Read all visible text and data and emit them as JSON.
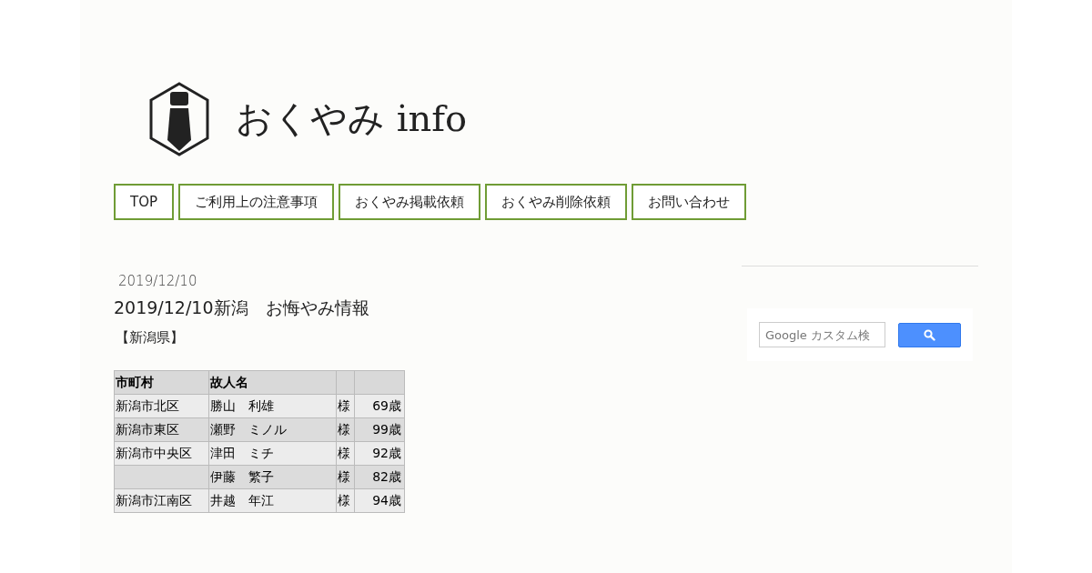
{
  "site": {
    "logo_text": "おくやみ info"
  },
  "nav": [
    {
      "label": "TOP"
    },
    {
      "label": "ご利用上の注意事項"
    },
    {
      "label": "おくやみ掲載依頼"
    },
    {
      "label": "おくやみ削除依頼"
    },
    {
      "label": "お問い合わせ"
    }
  ],
  "post": {
    "date": "2019/12/10",
    "title": "2019/12/10新潟　お悔やみ情報",
    "region": "【新潟県】"
  },
  "table": {
    "columns": [
      "市町村",
      "故人名",
      "",
      ""
    ],
    "rows": [
      {
        "city": "新潟市北区",
        "name": "勝山　利雄",
        "honorific": "様",
        "age": "69",
        "unit": "歳"
      },
      {
        "city": "新潟市東区",
        "name": "瀬野　ミノル",
        "honorific": "様",
        "age": "99",
        "unit": "歳"
      },
      {
        "city": "新潟市中央区",
        "name": "津田　ミチ",
        "honorific": "様",
        "age": "92",
        "unit": "歳"
      },
      {
        "city": "",
        "name": "伊藤　繁子",
        "honorific": "様",
        "age": "82",
        "unit": "歳"
      },
      {
        "city": "新潟市江南区",
        "name": "井越　年江",
        "honorific": "様",
        "age": "94",
        "unit": "歳"
      }
    ]
  },
  "search": {
    "placeholder": "Google カスタム検"
  }
}
